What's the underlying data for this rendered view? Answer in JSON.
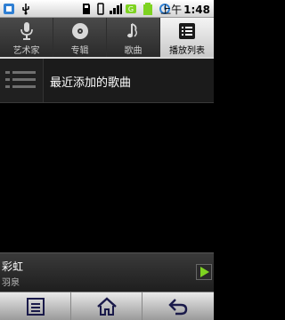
{
  "status_bar": {
    "ampm": "上午",
    "time": "1:48"
  },
  "tabs": [
    {
      "label": "艺术家",
      "icon": "microphone-icon",
      "active": false
    },
    {
      "label": "专辑",
      "icon": "disc-icon",
      "active": false
    },
    {
      "label": "歌曲",
      "icon": "music-note-icon",
      "active": false
    },
    {
      "label": "播放列表",
      "icon": "playlist-icon",
      "active": true
    }
  ],
  "playlists": [
    {
      "label": "最近添加的歌曲",
      "icon": "playlist-icon"
    }
  ],
  "now_playing": {
    "title": "彩虹",
    "artist": "羽泉",
    "play_icon": "play-icon"
  },
  "soft_keys": [
    {
      "icon": "menu-icon"
    },
    {
      "icon": "home-icon"
    },
    {
      "icon": "back-icon"
    }
  ],
  "colors": {
    "accent_green": "#7ed321",
    "tab_active_bg": "#e6e6e6"
  }
}
